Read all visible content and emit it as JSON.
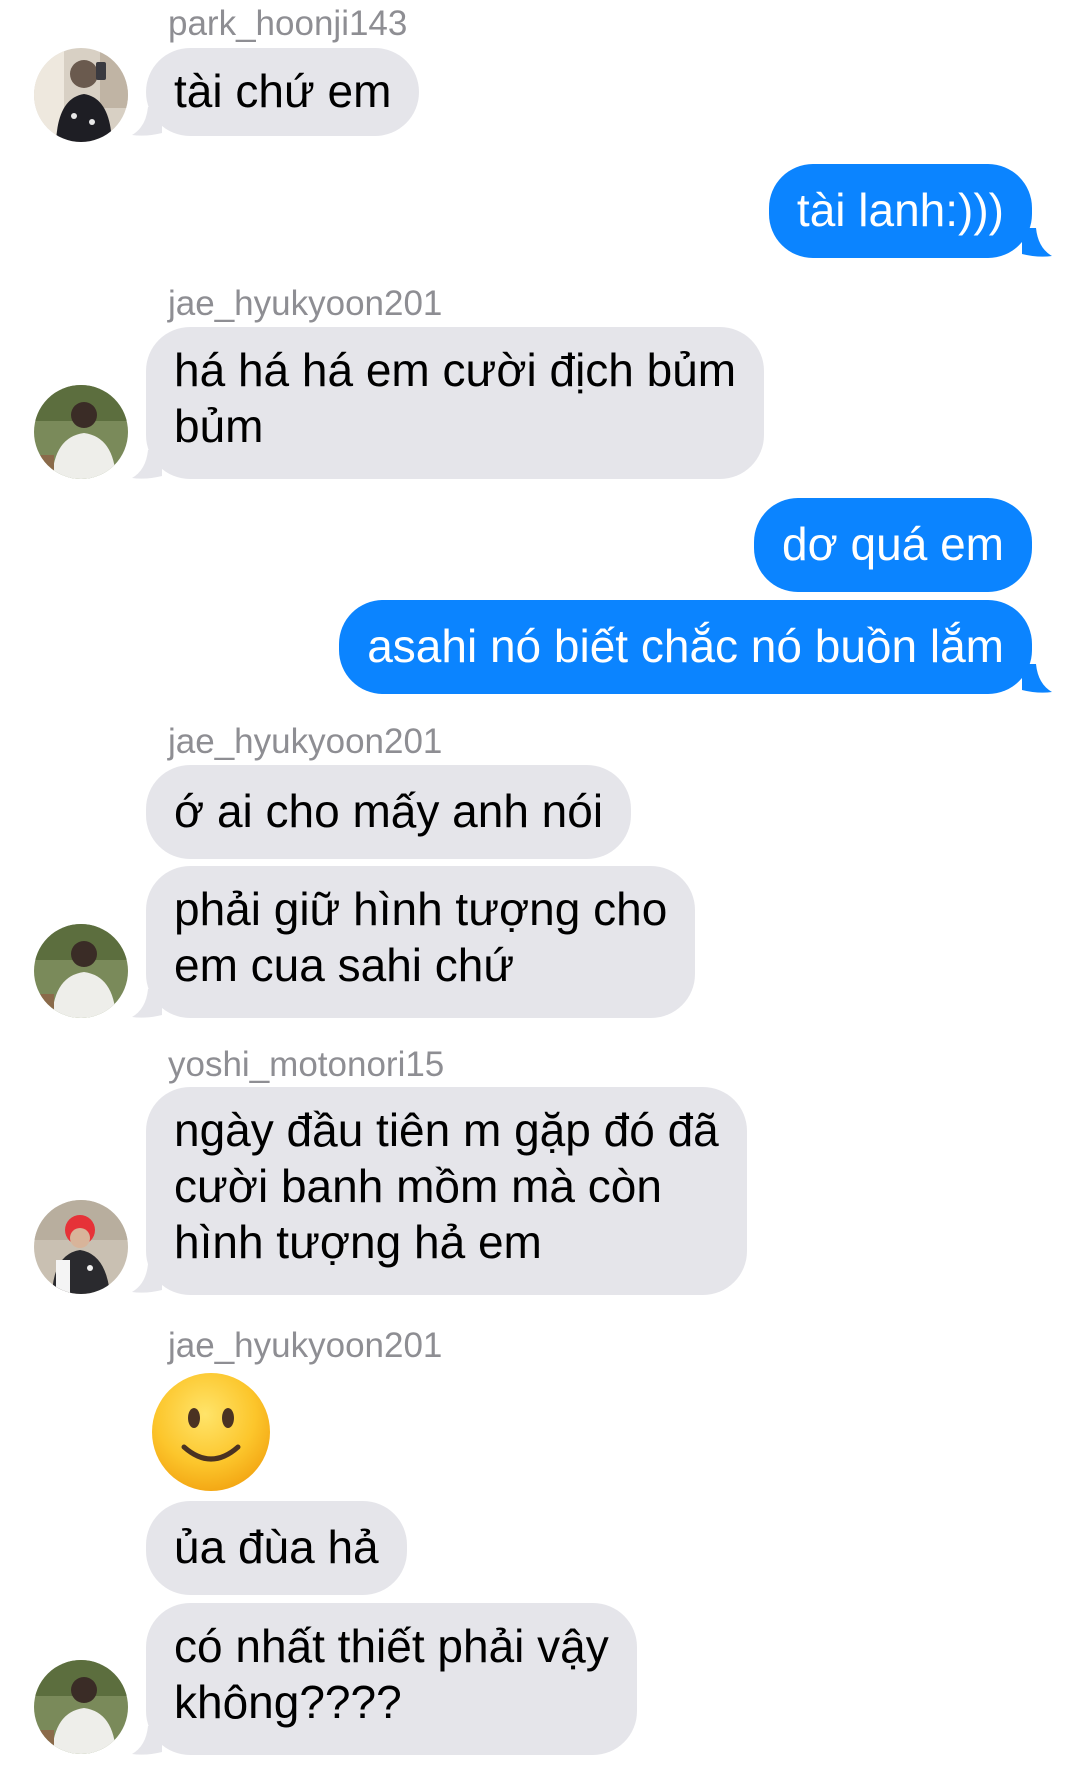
{
  "colors": {
    "sent_bubble": "#0b84ff",
    "received_bubble": "#e5e5ea",
    "sender_name": "#8e8e93"
  },
  "messages": [
    {
      "id": "m1",
      "direction": "received",
      "sender": "park_hoonji143",
      "text": "tài chứ em"
    },
    {
      "id": "m2",
      "direction": "sent",
      "text": "tài lanh:)))"
    },
    {
      "id": "m3",
      "direction": "received",
      "sender": "jae_hyukyoon201",
      "lines": [
        "há há há em cười địch bủm",
        "bủm"
      ]
    },
    {
      "id": "m4",
      "direction": "sent",
      "text": "dơ quá em"
    },
    {
      "id": "m5",
      "direction": "sent",
      "text": "asahi nó biết chắc nó buồn lắm"
    },
    {
      "id": "m6",
      "direction": "received",
      "sender": "jae_hyukyoon201",
      "text": "ớ ai cho mấy anh nói"
    },
    {
      "id": "m7",
      "direction": "received",
      "lines": [
        "phải giữ hình tượng cho",
        "em cua sahi chứ"
      ]
    },
    {
      "id": "m8",
      "direction": "received",
      "sender": "yoshi_motonori15",
      "lines": [
        "ngày đầu tiên m gặp đó đã",
        "cười banh mồm mà còn",
        "hình tượng hả em"
      ]
    },
    {
      "id": "m9",
      "direction": "received",
      "sender": "jae_hyukyoon201",
      "emoji": "slightly-smiling-face"
    },
    {
      "id": "m10",
      "direction": "received",
      "text": "ủa đùa hả"
    },
    {
      "id": "m11",
      "direction": "received",
      "lines": [
        "có nhất thiết phải vậy",
        "không????"
      ]
    }
  ]
}
